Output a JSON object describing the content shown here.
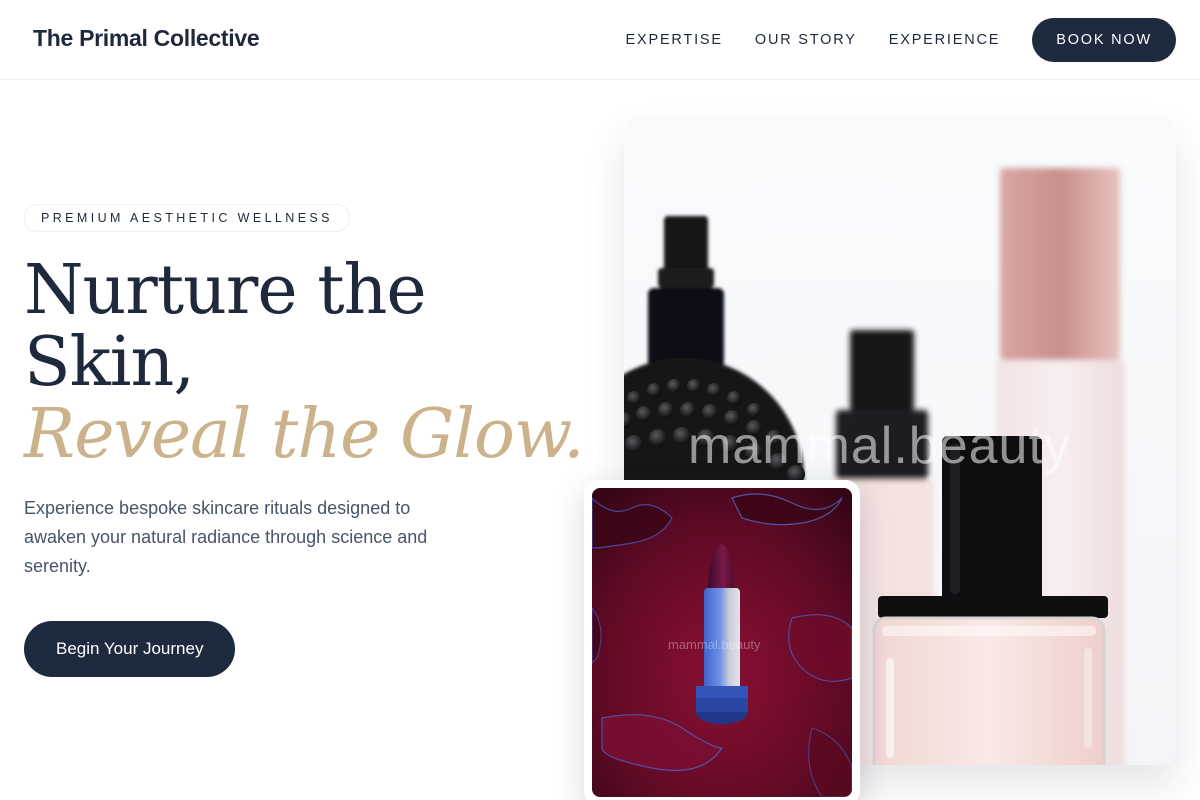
{
  "header": {
    "brand": "The Primal Collective",
    "nav": [
      "EXPERTISE",
      "OUR STORY",
      "EXPERIENCE"
    ],
    "book_label": "BOOK NOW"
  },
  "hero": {
    "badge": "PREMIUM AESTHETIC WELLNESS",
    "headline_line1": "Nurture the",
    "headline_line2": "Skin,",
    "headline_accent": "Reveal the Glow.",
    "description": "Experience bespoke skincare rituals designed to awaken your natural radiance through science and serenity.",
    "cta_label": "Begin Your Journey"
  },
  "images": {
    "main_watermark": "mammal.beauty",
    "small_watermark": "mammal.beauty"
  },
  "colors": {
    "navy": "#1e2a3e",
    "accent_gold": "#cbb28a",
    "text_muted": "#475569"
  }
}
